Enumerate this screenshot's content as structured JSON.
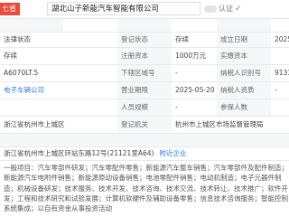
{
  "header": {
    "tag": "七省",
    "company_name": "湖北山子新能汽车智能有限公司",
    "verify_label": "认证",
    "verify_extra": "证书"
  },
  "rows": [
    {
      "c1": "",
      "c2": "",
      "c3": "",
      "c4": "",
      "c5": "",
      "c6": ""
    },
    {
      "c1": "法律状态",
      "c2": "",
      "c3": "登记状态",
      "c4": "存续",
      "c5": "成立日期",
      "c6": "2025"
    },
    {
      "c1": "存续",
      "c2": "",
      "c3": "注册资本",
      "c4": "1000万元",
      "c5": "实缴资本",
      "c6": ""
    },
    {
      "c1": "A6070LT.5",
      "c2": "",
      "c3": "下辖区域号",
      "c4": "-",
      "c5": "纳税人识别号",
      "c6": "9133"
    },
    {
      "c1": "电子车辆公司",
      "c2": "",
      "c3": "营业期限",
      "c4": "2025-05-20 至 无固定期限",
      "c5": "纳税人资质",
      "c6": "-"
    },
    {
      "c1": "",
      "c2": "",
      "c3": "人员规模",
      "c4": "-",
      "c5": "参保人数",
      "c6": ""
    },
    {
      "c1": "浙江省杭州市上城区",
      "c2": "",
      "c3": "登记机关",
      "c4": "杭州市上城区市场监督管理局",
      "c5": "",
      "c6": ""
    },
    {
      "c1": "",
      "c2": "",
      "c3": "",
      "c4": "",
      "c5": "",
      "c6": ""
    }
  ],
  "address": "浙江省杭州市上城区环站东路12号(21121室A64)",
  "address_link": "附近企业",
  "scope": "一般项目：汽车零部件研发；汽车零配件零售；新能源汽车整车销售；汽车零部件及配件制造；新能源汽车电附件销售；新能源原动设备销售；电池零配件销售；电动机制造；电子元器件制造；机械设备研发；技术服务、技术开发、技术咨询、技术交流、技术转让、技术推广；软件开发；工程和技术研究和试验发展；计算机软硬件及辅助设备零售；信息技术咨询服务；智能控制系统集成；以自有资金从事投资活动"
}
